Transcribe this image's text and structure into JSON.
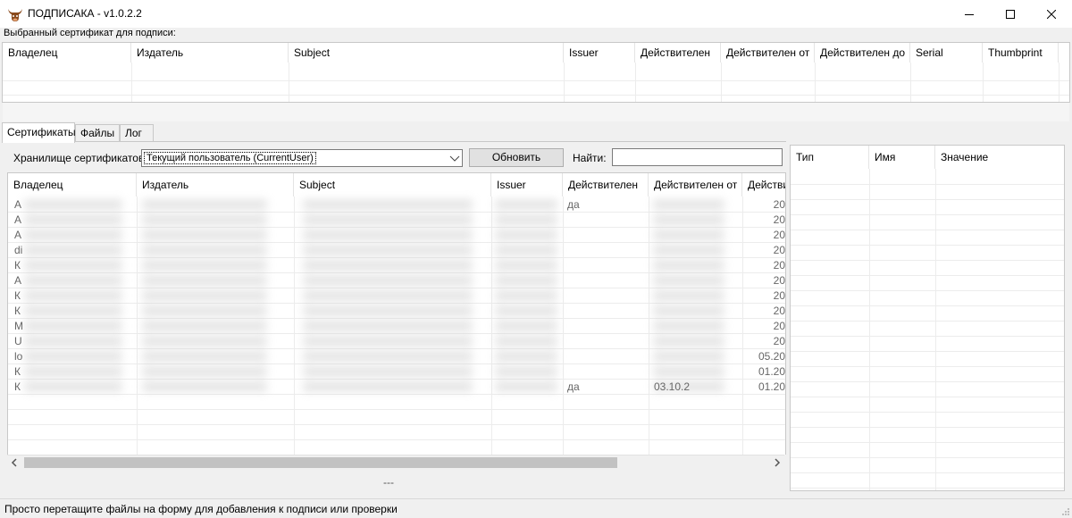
{
  "window": {
    "title": "ПОДПИСАКА - v1.0.2.2",
    "controls": [
      "minimize",
      "maximize",
      "close"
    ]
  },
  "selected": {
    "label": "Выбранный сертификат для подписи:",
    "columns": [
      "Владелец",
      "Издатель",
      "Subject",
      "Issuer",
      "Действителен",
      "Действителен от",
      "Действителен до",
      "Serial",
      "Thumbprint"
    ]
  },
  "tabs": [
    "Сертификаты",
    "Файлы",
    "Лог"
  ],
  "active_tab": "Сертификаты",
  "toolbar": {
    "store_label": "Хранилище сертификатов:",
    "store_value": "Текущий пользователь (CurrentUser)",
    "refresh_label": "Обновить",
    "find_label": "Найти:",
    "find_value": ""
  },
  "certs": {
    "columns": [
      "Владелец",
      "Издатель",
      "Subject",
      "Issuer",
      "Действителен",
      "Действителен от",
      "Действи"
    ],
    "rows": [
      {
        "owner": "А",
        "valid": "да",
        "to": "20"
      },
      {
        "owner": "А",
        "valid": "",
        "to": "20"
      },
      {
        "owner": "А",
        "valid": "",
        "to": "20"
      },
      {
        "owner": "di",
        "valid": "",
        "to": "20"
      },
      {
        "owner": "К",
        "valid": "",
        "to": "20"
      },
      {
        "owner": "А",
        "valid": "",
        "to": "20"
      },
      {
        "owner": "К",
        "valid": "",
        "to": "20"
      },
      {
        "owner": "К",
        "valid": "",
        "to": "20"
      },
      {
        "owner": "М",
        "valid": "",
        "to": "20"
      },
      {
        "owner": "U",
        "valid": "",
        "to": "20"
      },
      {
        "owner": "lo",
        "valid": "",
        "to": "05.20"
      },
      {
        "owner": "К",
        "valid": "",
        "to": "01.20"
      },
      {
        "owner": "К",
        "valid": "да",
        "from": "03.10.2",
        "to": "01.20"
      }
    ]
  },
  "details": {
    "columns": [
      "Тип",
      "Имя",
      "Значение"
    ]
  },
  "progress_text": "---",
  "status": "Просто перетащите файлы на форму для добавления к подписи или проверки"
}
